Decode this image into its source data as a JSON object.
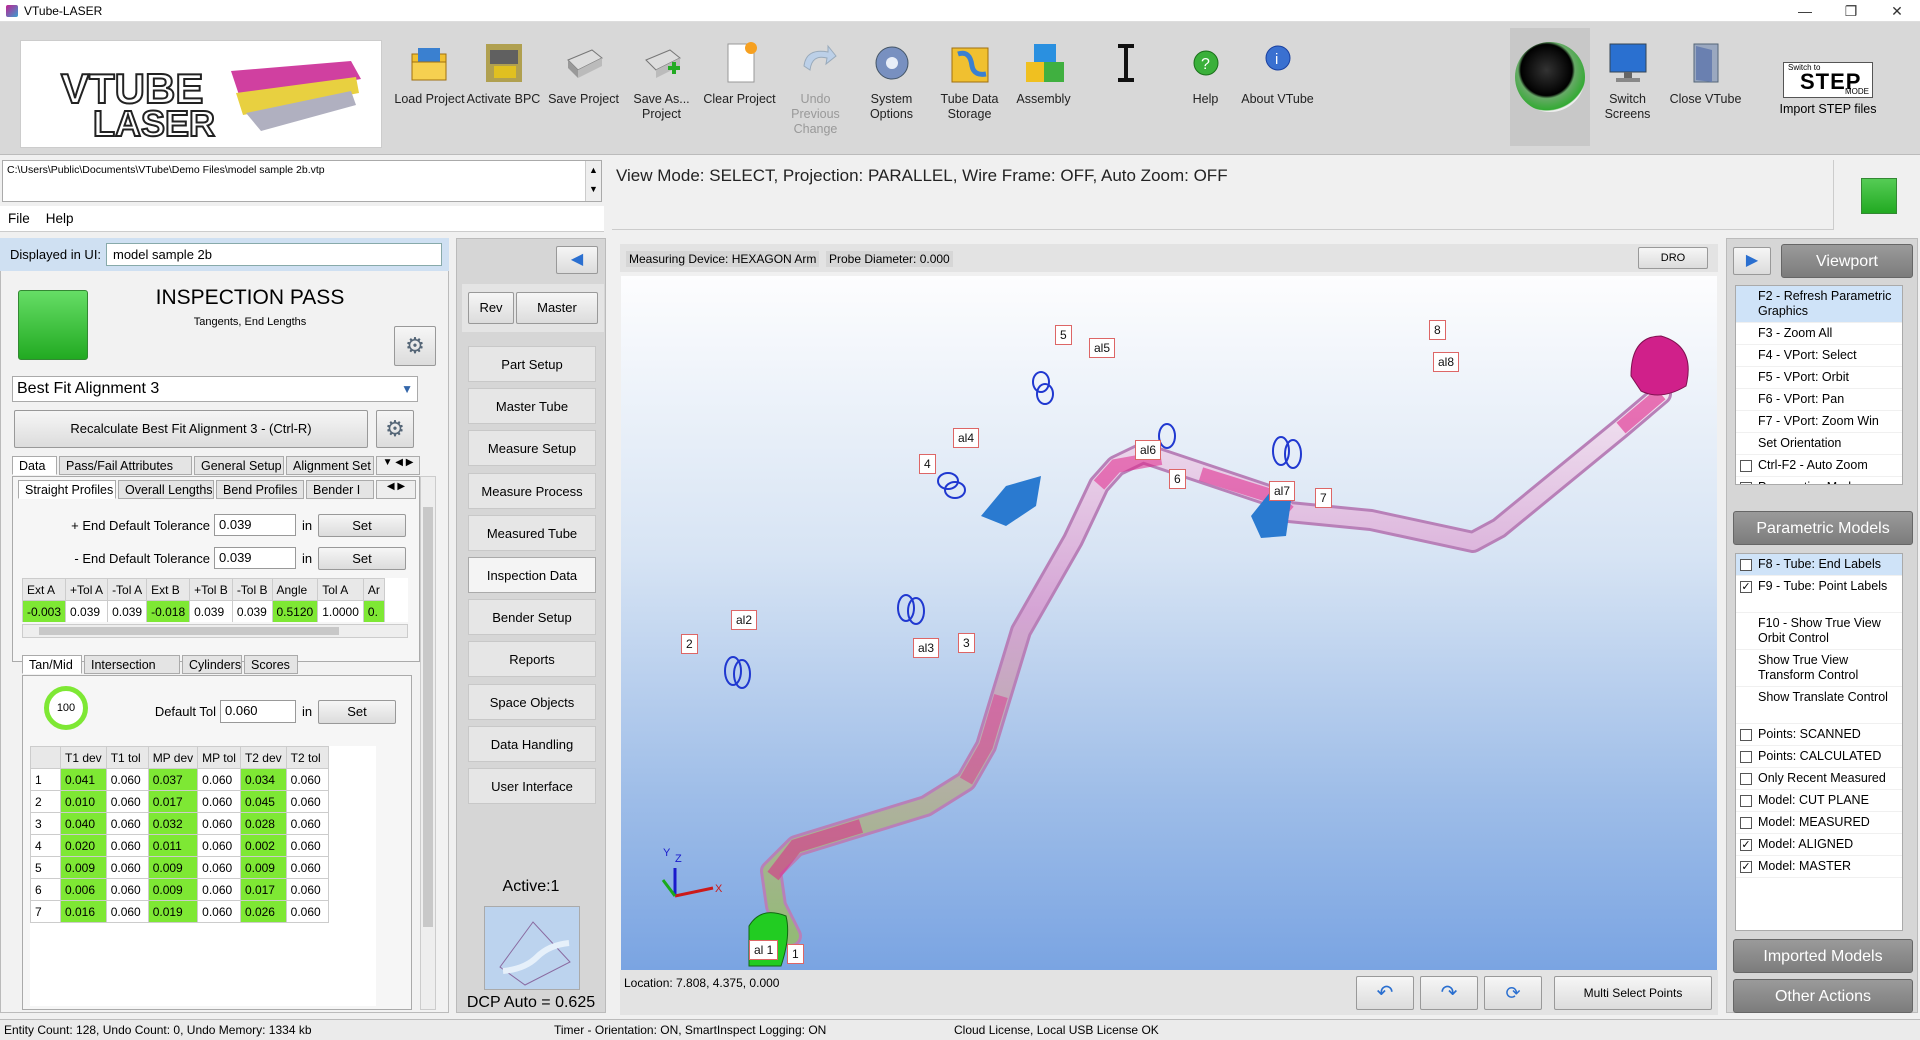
{
  "window": {
    "title": "VTube-LASER",
    "controls": [
      "—",
      "❐",
      "✕"
    ]
  },
  "toolbar": {
    "logo_line1": "VTUBE",
    "logo_line2": "LASER",
    "buttons": [
      {
        "label": "Load Project",
        "icon": "folder-icon"
      },
      {
        "label": "Activate BPC",
        "icon": "bender-icon"
      },
      {
        "label": "Save Project",
        "icon": "save-icon"
      },
      {
        "label": "Save As... Project",
        "icon": "save-as-icon"
      },
      {
        "label": "Clear Project",
        "icon": "clear-icon"
      },
      {
        "label": "Undo Previous Change",
        "icon": "undo-icon"
      },
      {
        "label": "System Options",
        "icon": "gear-icon"
      },
      {
        "label": "Tube Data Storage",
        "icon": "storage-icon"
      },
      {
        "label": "Assembly",
        "icon": "assembly-icon"
      },
      {
        "label": "",
        "icon": "text-cursor-icon"
      },
      {
        "label": "Help",
        "icon": "help-icon"
      },
      {
        "label": "About VTube",
        "icon": "info-icon"
      },
      {
        "label": "",
        "icon": "camera-icon"
      },
      {
        "label": "Switch Screens",
        "icon": "monitor-icon"
      },
      {
        "label": "Close VTube",
        "icon": "door-icon"
      }
    ],
    "step": {
      "small": "Switch to",
      "big": "STEP",
      "mode": "MODE",
      "label": "Import STEP files"
    }
  },
  "path": "C:\\Users\\Public\\Documents\\VTube\\Demo Files\\model sample 2b.vtp",
  "menu": [
    "File",
    "Help"
  ],
  "viewmode": "View Mode: SELECT, Projection: PARALLEL, Wire Frame: OFF, Auto Zoom: OFF",
  "left": {
    "disp_label": "Displayed in UI:",
    "disp_value": "model sample 2b",
    "pass_title": "INSPECTION PASS",
    "pass_sub": "Tangents, End Lengths",
    "alignment": "Best Fit Alignment 3",
    "recalc": "Recalculate Best Fit Alignment 3 - (Ctrl-R)",
    "tabs1": [
      "Data",
      "Pass/Fail Attributes",
      "General Setup",
      "Alignment Set"
    ],
    "tabs2": [
      "Straight Profiles",
      "Overall Lengths",
      "Bend Profiles",
      "Bender I"
    ],
    "tol_plus_label": "+ End Default Tolerance",
    "tol_plus": "0.039",
    "tol_minus_label": "- End Default Tolerance",
    "tol_minus": "0.039",
    "unit": "in",
    "set": "Set",
    "sp_headers": [
      "Ext A",
      "+Tol A",
      "-Tol A",
      "Ext B",
      "+Tol B",
      "-Tol B",
      "Angle",
      "Tol A",
      "Ar"
    ],
    "sp_row": [
      "-0.003",
      "0.039",
      "0.039",
      "-0.018",
      "0.039",
      "0.039",
      "0.5120",
      "1.0000",
      "0."
    ],
    "tabs3": [
      "Tan/Mid",
      "Intersection",
      "Cylinders",
      "Scores"
    ],
    "score": "100",
    "default_tol_label": "Default Tol",
    "default_tol": "0.060",
    "tm_headers": [
      "",
      "T1 dev",
      "T1 tol",
      "MP dev",
      "MP tol",
      "T2 dev",
      "T2 tol"
    ],
    "tm_rows": [
      [
        "1",
        "0.041",
        "0.060",
        "0.037",
        "0.060",
        "0.034",
        "0.060"
      ],
      [
        "2",
        "0.010",
        "0.060",
        "0.017",
        "0.060",
        "0.045",
        "0.060"
      ],
      [
        "3",
        "0.040",
        "0.060",
        "0.032",
        "0.060",
        "0.028",
        "0.060"
      ],
      [
        "4",
        "0.020",
        "0.060",
        "0.011",
        "0.060",
        "0.002",
        "0.060"
      ],
      [
        "5",
        "0.009",
        "0.060",
        "0.009",
        "0.060",
        "0.009",
        "0.060"
      ],
      [
        "6",
        "0.006",
        "0.060",
        "0.009",
        "0.060",
        "0.017",
        "0.060"
      ],
      [
        "7",
        "0.016",
        "0.060",
        "0.019",
        "0.060",
        "0.026",
        "0.060"
      ]
    ]
  },
  "mid": {
    "rev": "Rev",
    "master": "Master",
    "items": [
      "Part Setup",
      "Master Tube",
      "Measure Setup",
      "Measure Process",
      "Measured Tube",
      "Inspection Data",
      "Bender Setup",
      "Reports",
      "Space Objects",
      "Data Handling",
      "User Interface"
    ],
    "active": "Active:1",
    "dcp": "DCP Auto = 0.625"
  },
  "viewport": {
    "device": "Measuring Device: HEXAGON Arm",
    "probe": "Probe Diameter: 0.000",
    "dro": "DRO",
    "location": "Location: 7.808, 4.375, 0.000",
    "multi": "Multi Select Points",
    "labels": [
      "al 1",
      "1",
      "2",
      "al2",
      "al3",
      "3",
      "4",
      "al4",
      "5",
      "al5",
      "al6",
      "6",
      "al7",
      "7",
      "8",
      "al8"
    ],
    "axes": [
      "Y",
      "Z",
      "X"
    ]
  },
  "right": {
    "viewport_hdr": "Viewport",
    "param_hdr": "Parametric Models",
    "imported_hdr": "Imported Models",
    "other_hdr": "Other Actions",
    "vp_items": [
      "F2 - Refresh Parametric Graphics",
      "F3 - Zoom All",
      "F4 - VPort: Select",
      "F5 - VPort: Orbit",
      "F6 - VPort: Pan",
      "F7 - VPort: Zoom Win",
      "Set Orientation",
      "Ctrl-F2 - Auto Zoom",
      "Perspective Mode"
    ],
    "pm_items": [
      "F8 - Tube: End Labels",
      "F9 - Tube: Point Labels",
      "F10 - Show True View Orbit Control",
      "Show True View Transform Control",
      "Show Translate Control",
      "Points: SCANNED",
      "Points: CALCULATED",
      "Only Recent Measured",
      "Model: CUT PLANE",
      "Model: MEASURED",
      "Model: ALIGNED",
      "Model: MASTER"
    ]
  },
  "status": {
    "entity": "Entity Count: 128, Undo Count: 0, Undo Memory: 1334 kb",
    "timer": "Timer - Orientation: ON, SmartInspect Logging: ON",
    "license": "Cloud License, Local USB License OK"
  }
}
